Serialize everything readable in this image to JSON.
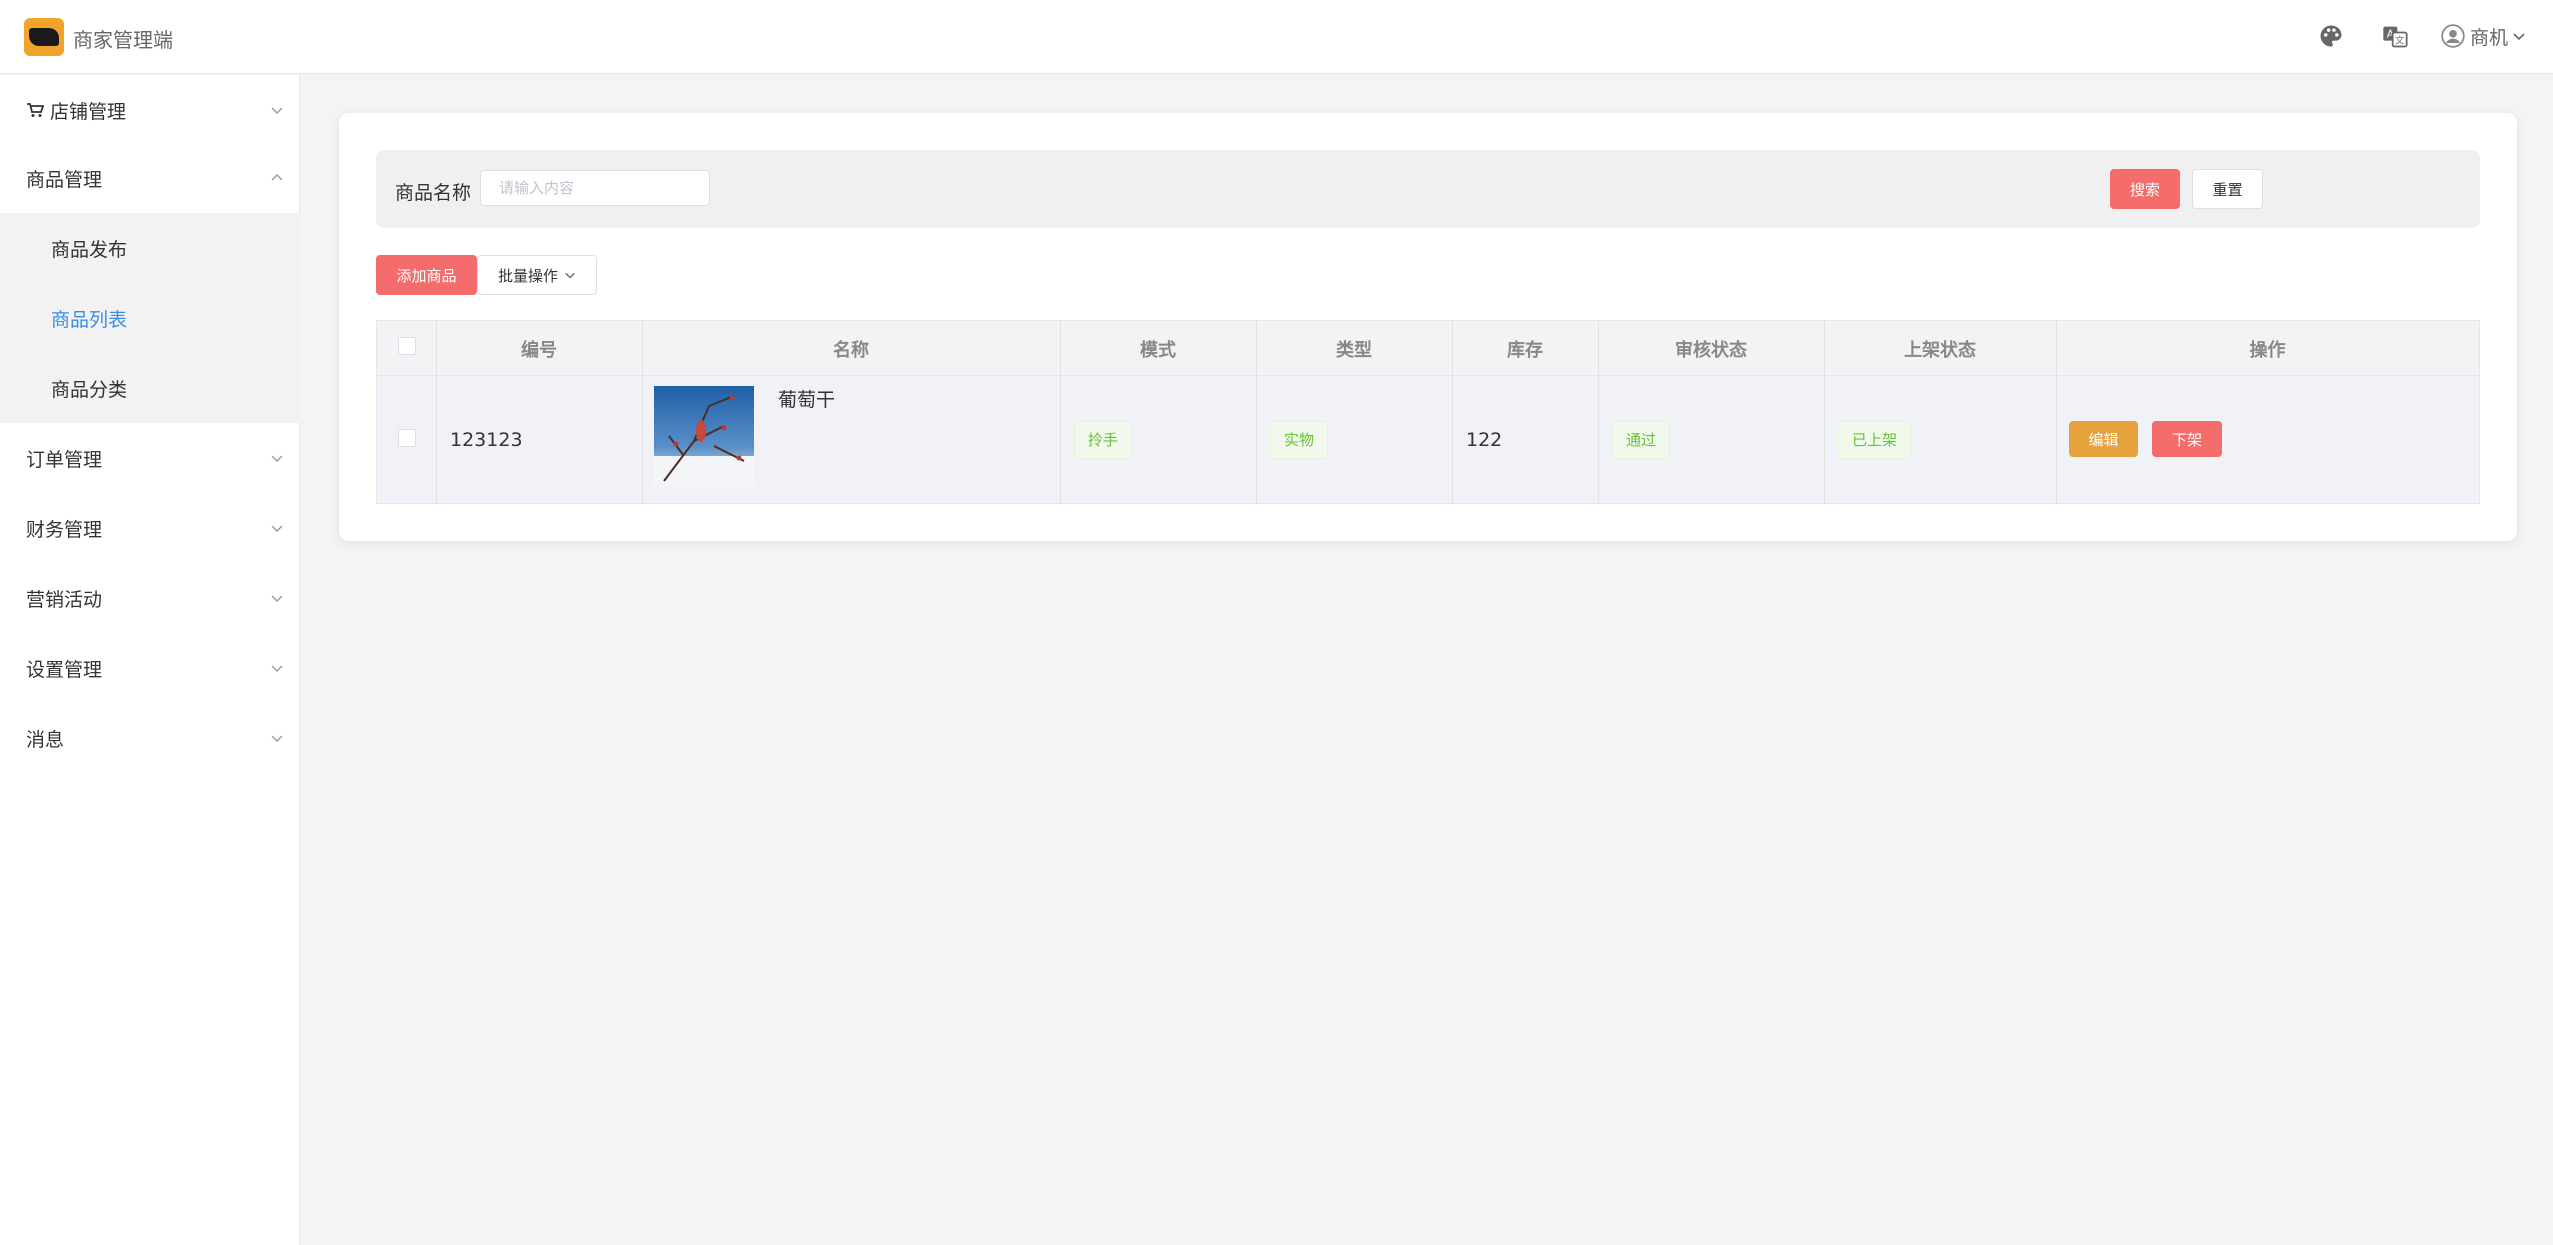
{
  "header": {
    "app_title": "商家管理端",
    "user_name": "商机",
    "icons": [
      "palette-icon",
      "translate-icon",
      "user-avatar-icon",
      "chevron-down-icon"
    ]
  },
  "sidebar": {
    "items": [
      {
        "label": "店铺管理",
        "icon": "cart-icon",
        "expanded": false
      },
      {
        "label": "商品管理",
        "expanded": true,
        "children": [
          {
            "label": "商品发布"
          },
          {
            "label": "商品列表",
            "active": true
          },
          {
            "label": "商品分类"
          }
        ]
      },
      {
        "label": "订单管理",
        "expanded": false
      },
      {
        "label": "财务管理",
        "expanded": false
      },
      {
        "label": "营销活动",
        "expanded": false
      },
      {
        "label": "设置管理",
        "expanded": false
      },
      {
        "label": "消息",
        "expanded": false
      }
    ]
  },
  "search": {
    "label": "商品名称",
    "value": "",
    "placeholder": "请输入内容",
    "search_label": "搜索",
    "reset_label": "重置"
  },
  "toolbar": {
    "add_label": "添加商品",
    "batch_label": "批量操作"
  },
  "table": {
    "columns": [
      "编号",
      "名称",
      "模式",
      "类型",
      "库存",
      "审核状态",
      "上架状态",
      "操作"
    ],
    "rows": [
      {
        "id": "123123",
        "name": "葡萄干",
        "mode": "拎手",
        "type": "实物",
        "stock": "122",
        "audit_status": "通过",
        "shelf_status": "已上架",
        "actions": {
          "edit": "编辑",
          "off_shelf": "下架"
        }
      }
    ]
  },
  "colors": {
    "accent_red": "#f56c6c",
    "edit_orange": "#e6a23c",
    "active_blue": "#3a8ee6",
    "tag_green": "#67c23a"
  }
}
